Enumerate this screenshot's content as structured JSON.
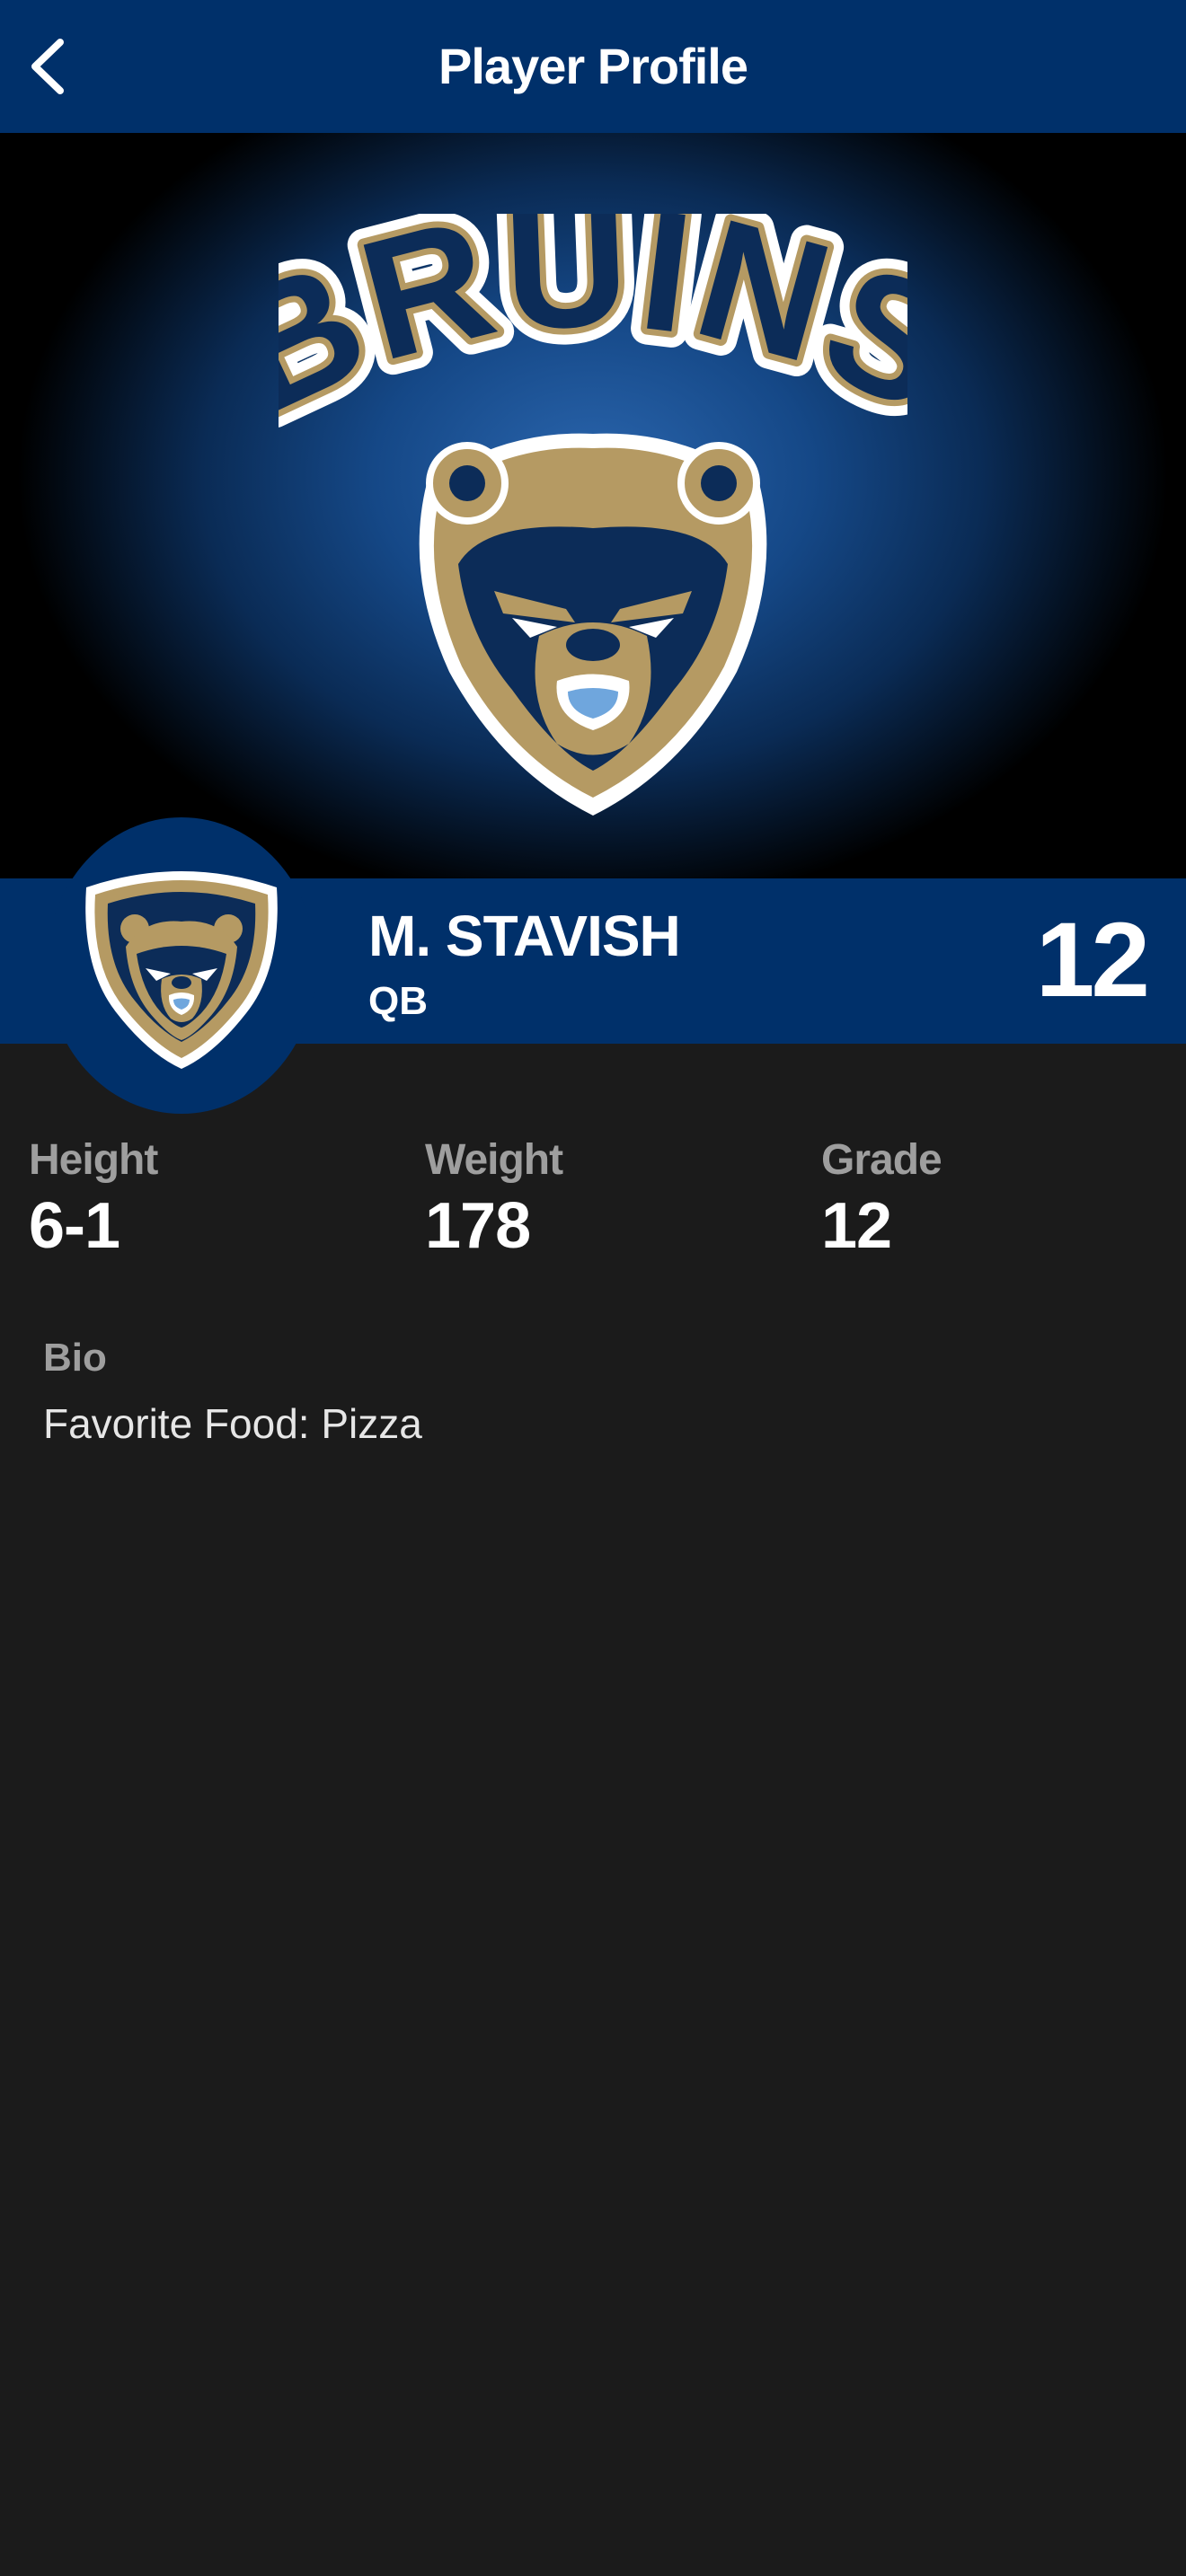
{
  "header": {
    "title": "Player Profile",
    "back_icon": "chevron-left-icon"
  },
  "team": {
    "logo_text": "BRUINS",
    "mascot": "bear",
    "colors": {
      "navy": "#00306a",
      "gold": "#b59a63",
      "white": "#ffffff"
    }
  },
  "player": {
    "name": "M. STAVISH",
    "position": "QB",
    "number": "12"
  },
  "stats": [
    {
      "label": "Height",
      "value": "6-1"
    },
    {
      "label": "Weight",
      "value": "178"
    },
    {
      "label": "Grade",
      "value": "12"
    }
  ],
  "bio": {
    "label": "Bio",
    "text": "Favorite Food: Pizza"
  }
}
